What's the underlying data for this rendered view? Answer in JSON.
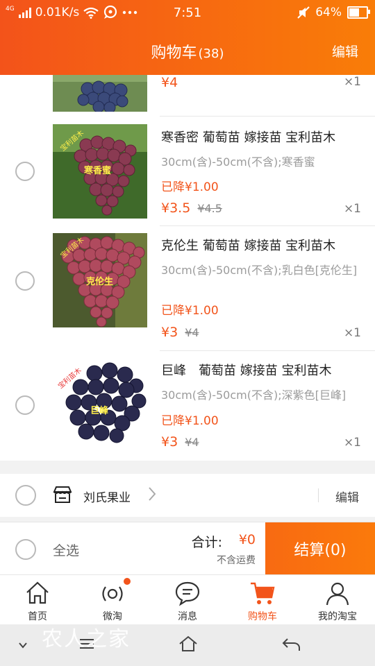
{
  "status_bar": {
    "network_type": "4G",
    "speed": "0.01K/s",
    "time": "7:51",
    "battery": "64%",
    "battery_level": 0.64
  },
  "header": {
    "title": "购物车",
    "count": "(38)",
    "edit": "编辑"
  },
  "items": [
    {
      "title": "",
      "spec": "",
      "discount": "",
      "price": "¥4",
      "original_price": "",
      "qty": "×1",
      "image_label": ""
    },
    {
      "title": "寒香密 葡萄苗 嫁接苗 宝利苗木",
      "spec": "30cm(含)-50cm(不含);寒香蜜",
      "discount": "已降¥1.00",
      "price": "¥3.5",
      "original_price": "¥4.5",
      "qty": "×1",
      "image_label": "寒香蜜",
      "badge": "宝利苗木"
    },
    {
      "title": "克伦生 葡萄苗 嫁接苗 宝利苗木",
      "spec": "30cm(含)-50cm(不含);乳白色[克伦生]",
      "discount": "已降¥1.00",
      "price": "¥3",
      "original_price": "¥4",
      "qty": "×1",
      "image_label": "克伦生",
      "badge": "宝利苗木"
    },
    {
      "title": "巨峰　葡萄苗 嫁接苗 宝利苗木",
      "spec": "30cm(含)-50cm(不含);深紫色[巨峰]",
      "discount": "已降¥1.00",
      "price": "¥3",
      "original_price": "¥4",
      "qty": "×1",
      "image_label": "巨峰",
      "badge": "宝利苗木"
    }
  ],
  "shop": {
    "name": "刘氏果业",
    "edit": "编辑"
  },
  "footer": {
    "select_all": "全选",
    "total_label": "合计:",
    "total_value": "¥0",
    "freight_note": "不含运费",
    "checkout": "结算(0)"
  },
  "tabs": [
    {
      "label": "首页",
      "icon": "home-icon"
    },
    {
      "label": "微淘",
      "icon": "broadcast-icon"
    },
    {
      "label": "消息",
      "icon": "message-icon"
    },
    {
      "label": "购物车",
      "icon": "cart-icon",
      "active": true
    },
    {
      "label": "我的淘宝",
      "icon": "user-icon"
    }
  ],
  "watermark": "农人之家",
  "colors": {
    "accent": "#f2541b",
    "header": "#f76a10"
  }
}
